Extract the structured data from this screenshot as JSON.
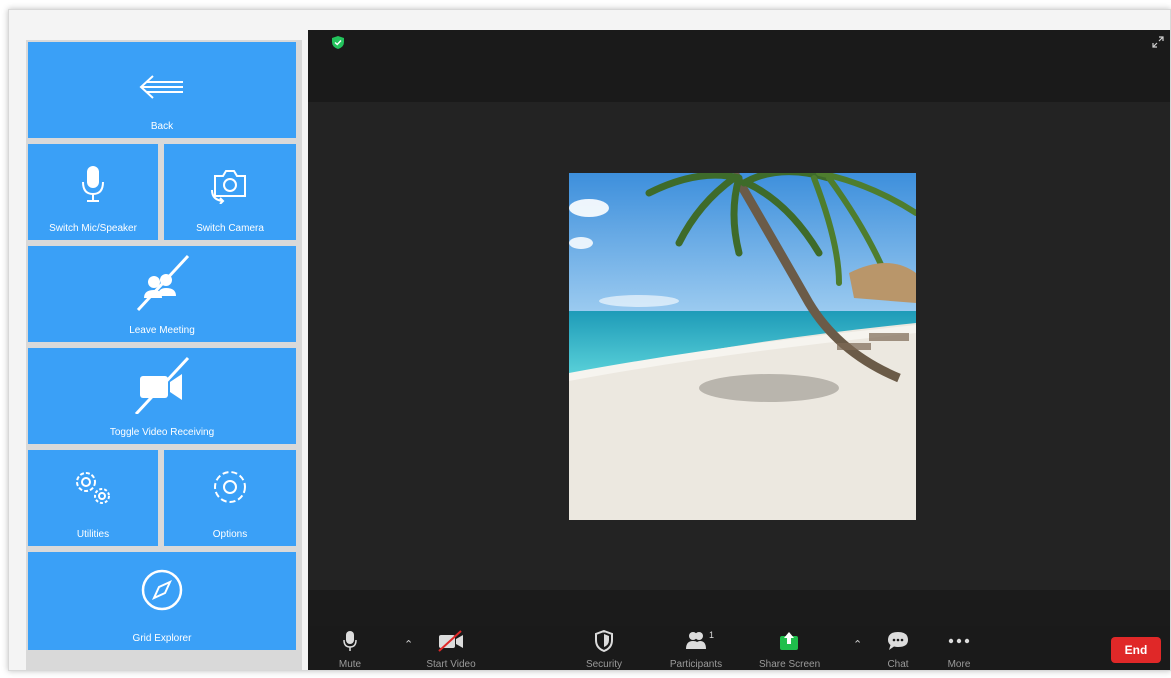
{
  "grid": {
    "back_label": "Back",
    "mic_label": "Switch Mic/Speaker",
    "camera_label": "Switch Camera",
    "leave_label": "Leave Meeting",
    "video_label": "Toggle Video Receiving",
    "utilities_label": "Utilities",
    "options_label": "Options",
    "explorer_label": "Grid Explorer",
    "tile_color": "#3aa0f7"
  },
  "meeting": {
    "participants_count": "1",
    "end_label": "End",
    "toolbar": {
      "mute": "Mute",
      "start_video": "Start Video",
      "security": "Security",
      "participants": "Participants",
      "share_screen": "Share Screen",
      "chat": "Chat",
      "more": "More"
    },
    "colors": {
      "end": "#e02828",
      "share": "#1fbf4c",
      "secure": "#23c35c"
    }
  }
}
